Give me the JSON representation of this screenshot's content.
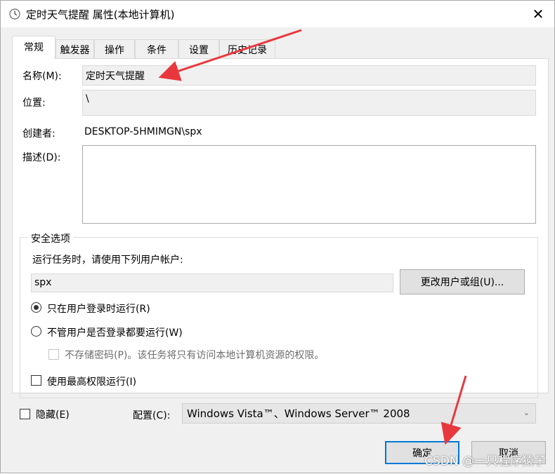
{
  "window": {
    "title": "定时天气提醒 属性(本地计算机)",
    "close_glyph": "✕"
  },
  "tabs": [
    {
      "label": "常规",
      "active": true
    },
    {
      "label": "触发器",
      "active": false
    },
    {
      "label": "操作",
      "active": false
    },
    {
      "label": "条件",
      "active": false
    },
    {
      "label": "设置",
      "active": false
    },
    {
      "label": "历史记录",
      "active": false
    }
  ],
  "general": {
    "name_label": "名称(M):",
    "name_value": "定时天气提醒",
    "location_label": "位置:",
    "location_value": "\\",
    "author_label": "创建者:",
    "author_value": "DESKTOP-5HMIMGN\\spx",
    "description_label": "描述(D):",
    "description_value": ""
  },
  "security": {
    "group_title": "安全选项",
    "run_as_prompt": "运行任务时，请使用下列用户帐户:",
    "user_account": "spx",
    "change_user_button": "更改用户或组(U)...",
    "run_only_logged_on": "只在用户登录时运行(R)",
    "run_whether_logged_on": "不管用户是否登录都要运行(W)",
    "do_not_store_password": "不存储密码(P)。该任务将只有访问本地计算机资源的权限。",
    "run_highest_privileges": "使用最高权限运行(I)",
    "selected_option": "run_only_logged_on"
  },
  "footer": {
    "hidden_label": "隐藏(E)",
    "configure_label": "配置(C):",
    "configure_value": "Windows Vista™、Windows Server™ 2008",
    "ok_button": "确定",
    "cancel_button": "取消"
  },
  "watermark": "CSDN @一只程序猿子",
  "colors": {
    "accent": "#0078d7",
    "annotation_arrow": "#e8383d",
    "dialog_bg": "#f0f0f0"
  }
}
